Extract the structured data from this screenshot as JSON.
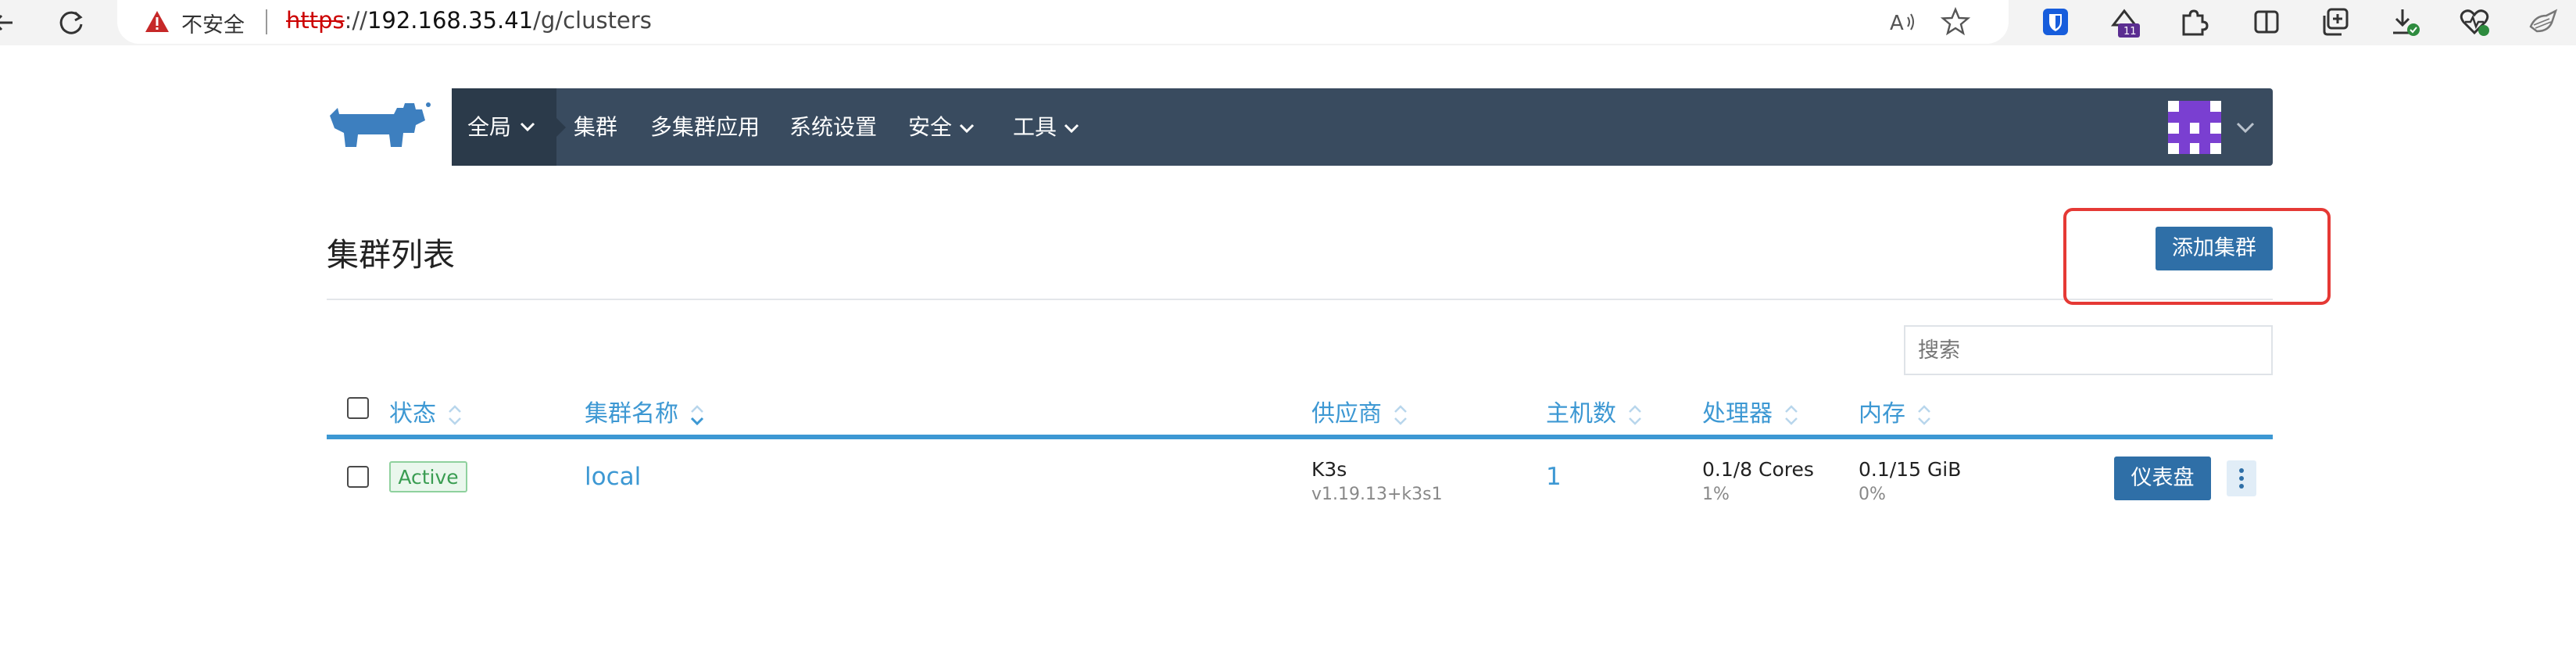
{
  "browser": {
    "insecure_label": "不安全",
    "url_protocol": "https",
    "url_separator": "://",
    "url_host": "192.168.35.41",
    "url_path": "/g/clusters",
    "extension_badge": "11"
  },
  "nav": {
    "global_label": "全局",
    "items": [
      "集群",
      "多集群应用",
      "系统设置",
      "安全",
      "工具"
    ]
  },
  "page": {
    "title": "集群列表",
    "add_button_label": "添加集群",
    "search_placeholder": "搜索"
  },
  "table": {
    "columns": [
      "状态",
      "集群名称",
      "供应商",
      "主机数",
      "处理器",
      "内存"
    ],
    "rows": [
      {
        "status": "Active",
        "name": "local",
        "provider": "K3s",
        "provider_version": "v1.19.13+k3s1",
        "hosts": "1",
        "cpu": "0.1/8 Cores",
        "cpu_pct": "1%",
        "memory": "0.1/15 GiB",
        "memory_pct": "0%",
        "dashboard_label": "仪表盘"
      }
    ]
  },
  "colors": {
    "nav_bg": "#394b5f",
    "nav_active_bg": "#2b3a4a",
    "primary": "#2f6fa7",
    "link": "#3d98d3",
    "status_active": "#3a9d52",
    "highlight": "#e53935"
  }
}
